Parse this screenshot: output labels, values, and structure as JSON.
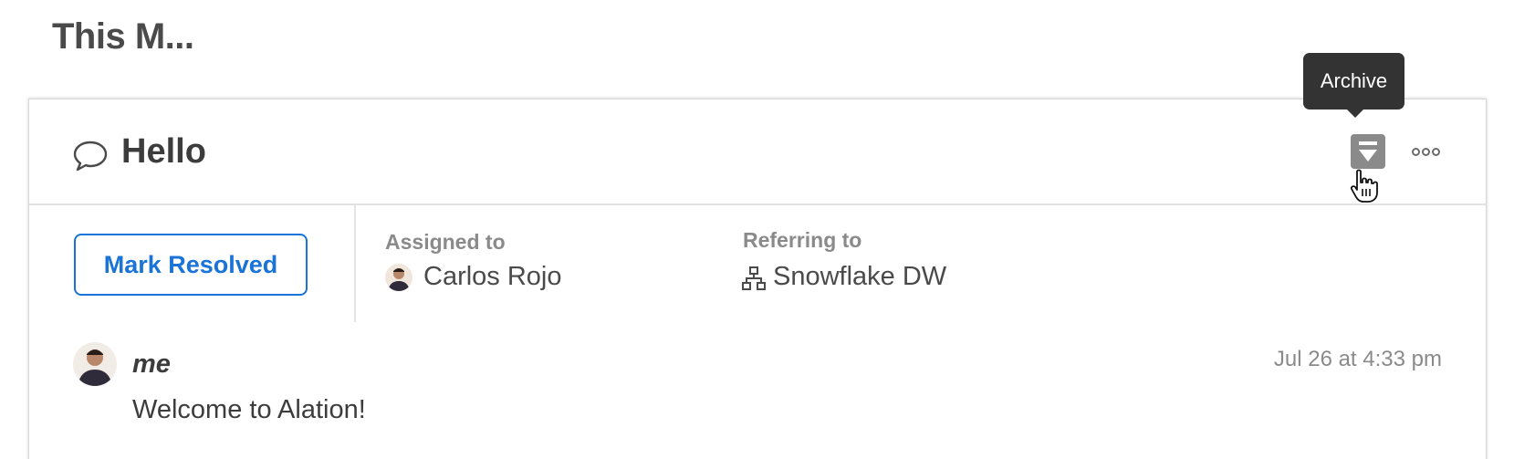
{
  "page": {
    "title": "This M..."
  },
  "thread": {
    "title": "Hello",
    "icons": {
      "bubble": "speech-bubble-icon",
      "archive": "archive-icon",
      "more": "more-options-icon"
    },
    "tooltip": "Archive"
  },
  "meta": {
    "resolve_label": "Mark Resolved",
    "assigned_label": "Assigned to",
    "assignee": "Carlos Rojo",
    "referring_label": "Referring to",
    "referring_value": "Snowflake DW"
  },
  "message": {
    "author": "me",
    "timestamp": "Jul 26 at 4:33 pm",
    "body": "Welcome to Alation!"
  },
  "colors": {
    "accent": "#1a73d6",
    "tooltip_bg": "#333333",
    "muted": "#8a8a8a"
  }
}
